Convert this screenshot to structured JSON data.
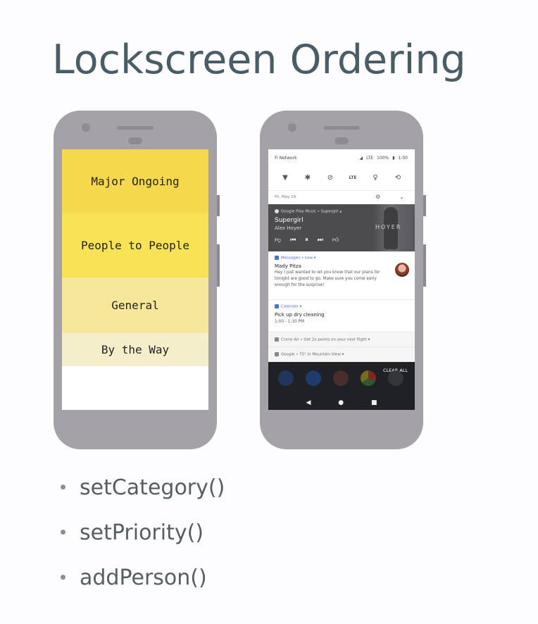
{
  "slide": {
    "title": "Lockscreen Ordering",
    "bullets": [
      "setCategory()",
      "setPriority()",
      "addPerson()"
    ]
  },
  "left_phone": {
    "bands": [
      "Major Ongoing",
      "People to People",
      "General",
      "By the Way"
    ],
    "colors": [
      "#f5d84c",
      "#f8e255",
      "#f6e79a",
      "#f4eecb"
    ]
  },
  "right_phone": {
    "status": {
      "network": "Fi Network",
      "signal": "LTE",
      "battery": "100%",
      "time": "1:00"
    },
    "quick_settings": [
      "wifi-icon",
      "bluetooth-icon",
      "dnd-icon",
      "LTE",
      "flashlight-icon",
      "rotate-icon"
    ],
    "qs_lte_label": "LTE",
    "date": "Fri, May 19",
    "music": {
      "app": "Google Play Music • Supergirl ▴",
      "song": "Supergirl",
      "artist": "Alex Hoyer",
      "art_text": "HOYER"
    },
    "messages": {
      "header": "Messages • now ▾",
      "title": "Mady Pitza",
      "body": "Hey I just wanted to let you know that our plans for tonight are good to go. Make sure you come early enough for the surprise!"
    },
    "calendar": {
      "header": "Calendar ▾",
      "title": "Pick up dry cleaning",
      "time": "1:00 - 1:30 PM"
    },
    "crane": "Crane Air • Get 2x points on your next flight ▾",
    "google": "Google • 75° in Mountain View ▾",
    "clear_all": "CLEAR ALL"
  }
}
